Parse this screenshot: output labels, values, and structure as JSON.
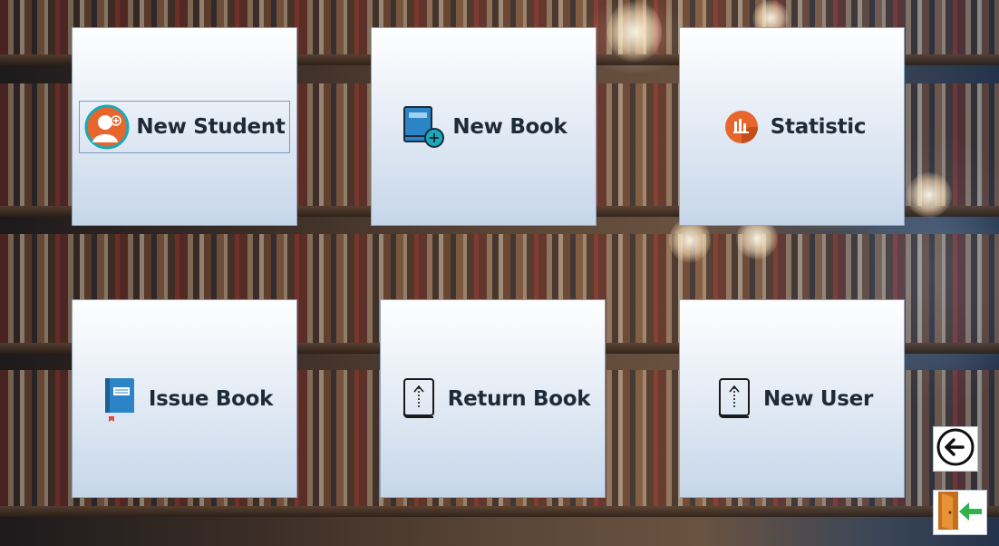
{
  "tiles": {
    "new_student": {
      "label": "New Student",
      "icon": "add-user-icon"
    },
    "new_book": {
      "label": "New Book",
      "icon": "add-book-icon"
    },
    "statistic": {
      "label": "Statistic",
      "icon": "chart-icon"
    },
    "issue_book": {
      "label": "Issue Book",
      "icon": "book-icon"
    },
    "return_book": {
      "label": "Return Book",
      "icon": "book-upload-icon"
    },
    "new_user": {
      "label": "New User",
      "icon": "book-upload-icon"
    }
  },
  "side": {
    "back_icon": "back-arrow-icon",
    "logout_icon": "exit-door-icon"
  },
  "colors": {
    "tile_top": "#ffffff",
    "tile_bottom": "#c6d6ea",
    "label": "#1f2a38",
    "accent_orange": "#e6662e",
    "accent_teal": "#19a9b8",
    "accent_blue": "#2b84c6",
    "exit_green": "#2fb34a"
  }
}
